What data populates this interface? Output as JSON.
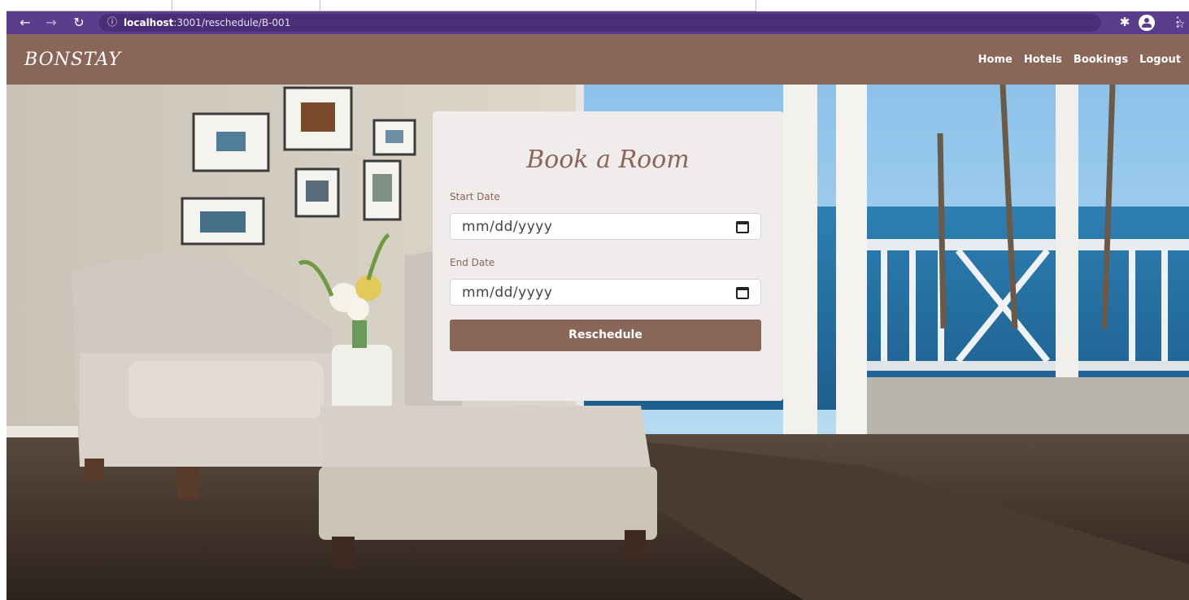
{
  "browser": {
    "url_host": "localhost",
    "url_path": ":3001/reschedule/B-001"
  },
  "site": {
    "brand": "BONSTAY",
    "nav": [
      "Home",
      "Hotels",
      "Bookings",
      "Logout"
    ]
  },
  "form": {
    "title": "Book a Room",
    "start_label": "Start Date",
    "start_value": "mm/dd/yyyy",
    "end_label": "End Date",
    "end_value": "mm/dd/yyyy",
    "submit_label": "Reschedule"
  },
  "colors": {
    "browser_bar": "#5b3d8e",
    "navbar": "#8a6659",
    "card": "#efeceb",
    "accent": "#8a6659"
  }
}
